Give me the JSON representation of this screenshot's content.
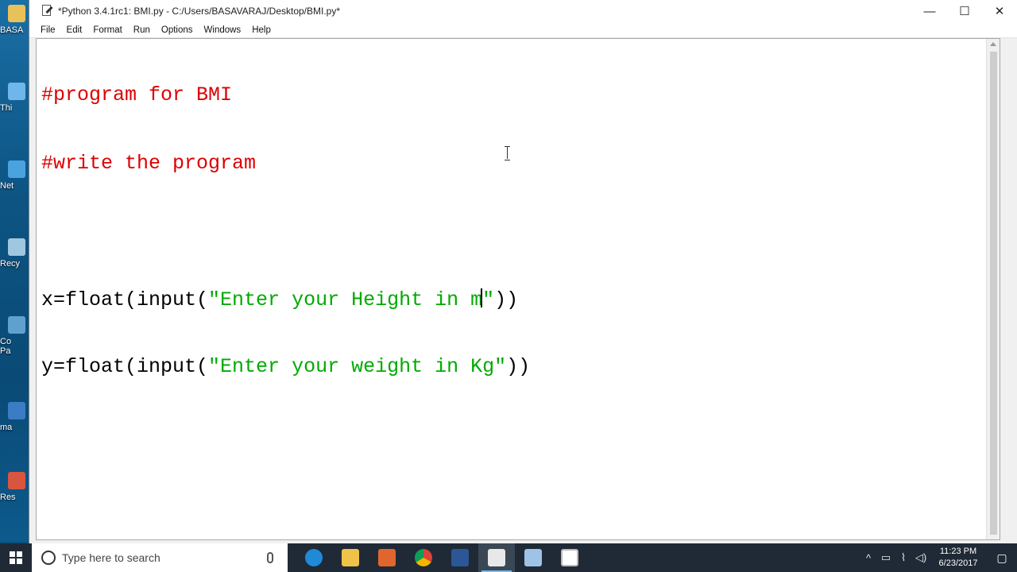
{
  "window": {
    "title": "*Python 3.4.1rc1: BMI.py - C:/Users/BASAVARAJ/Desktop/BMI.py*",
    "minimize": "—",
    "maximize": "☐",
    "close": "✕"
  },
  "menu": {
    "items": [
      "File",
      "Edit",
      "Format",
      "Run",
      "Options",
      "Windows",
      "Help"
    ]
  },
  "editor": {
    "line1": "#program for BMI",
    "line2": "#write the program",
    "line4_a": "x=float(input(",
    "line4_str_a": "\"Enter your Height in m",
    "line4_str_b": "\"",
    "line4_c": "))",
    "line5_a": "y=float(input(",
    "line5_str": "\"Enter your weight in Kg\"",
    "line5_c": "))"
  },
  "desktop": {
    "labels": [
      "BASA",
      "Thi",
      "Net",
      "Recy",
      "Co",
      "Pa",
      "ma",
      "Res"
    ]
  },
  "taskbar": {
    "search_placeholder": "Type here to search",
    "time": "11:23 PM",
    "date": "6/23/2017"
  },
  "colors": {
    "comment": "#dd0000",
    "string": "#00aa00",
    "taskbar": "#1f2a36"
  }
}
